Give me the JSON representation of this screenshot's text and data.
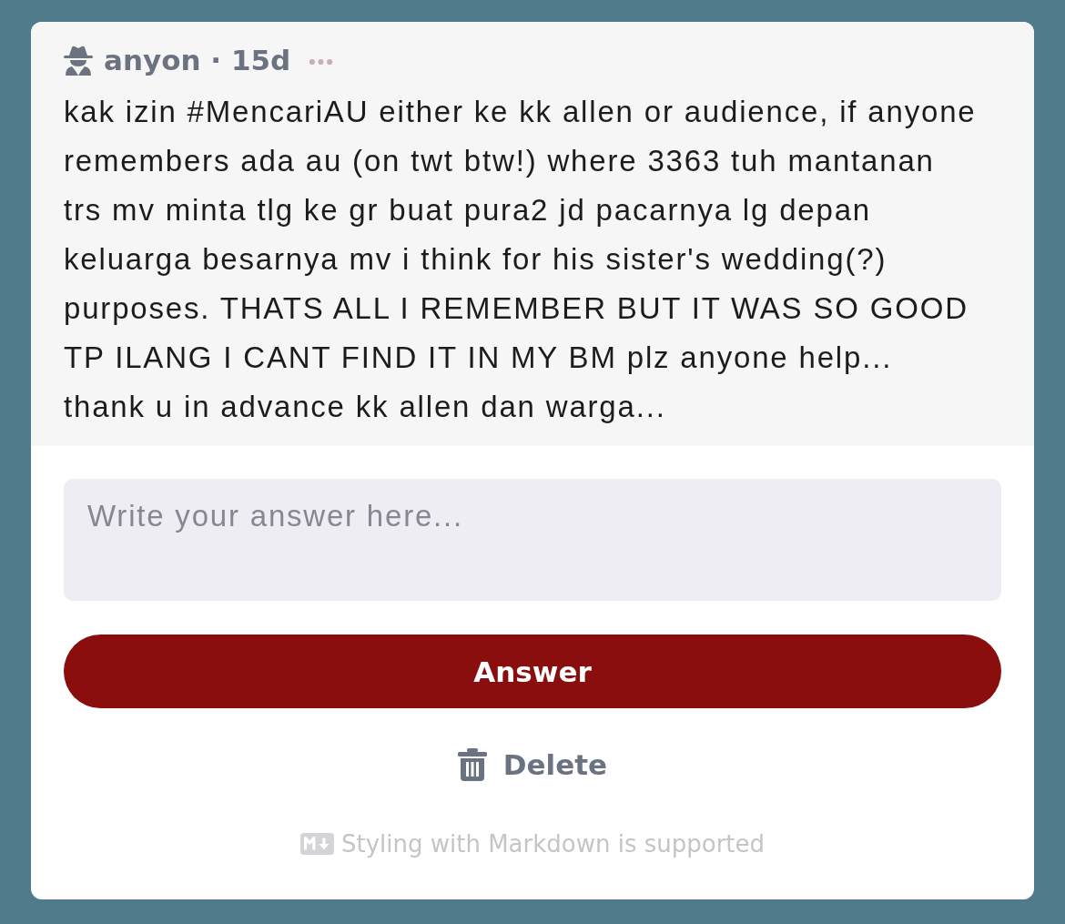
{
  "question": {
    "byline": "anyon · 15d",
    "text": "kak izin #MencariAU either ke kk allen or audience, if anyone remembers ada au (on twt btw!) where 3363 tuh mantanan trs mv minta tlg ke gr buat pura2 jd pacarnya lg depan keluarga besarnya mv i think for his sister's wedding(?) purposes. THATS ALL I REMEMBER BUT IT WAS SO GOOD TP ILANG I CANT FIND IT IN MY BM plz anyone help... thank u in advance kk allen dan warga..."
  },
  "answer_field": {
    "placeholder": "Write your answer here..."
  },
  "buttons": [
    {
      "kind": "primary",
      "label": "Answer"
    },
    {
      "kind": "delete",
      "label": "Delete"
    }
  ],
  "footer": {
    "note": "Styling with Markdown is supported"
  }
}
